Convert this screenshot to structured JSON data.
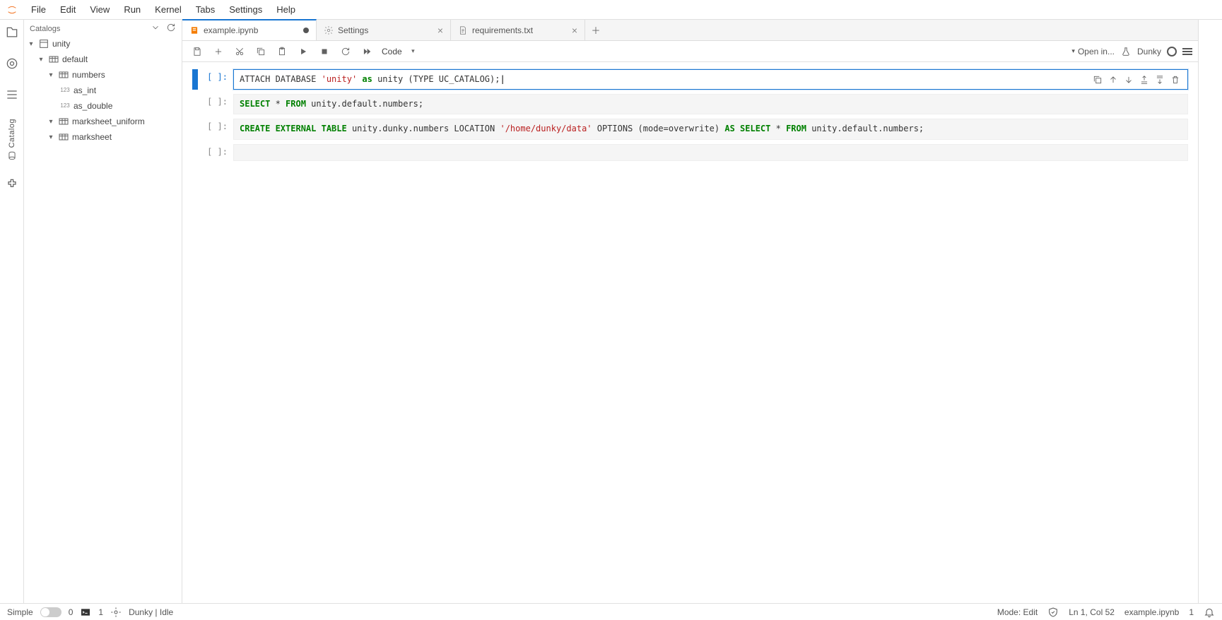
{
  "menu": {
    "items": [
      "File",
      "Edit",
      "View",
      "Run",
      "Kernel",
      "Tabs",
      "Settings",
      "Help"
    ]
  },
  "sidebar": {
    "title": "Catalogs",
    "tree": {
      "unity": "unity",
      "default": "default",
      "numbers": "numbers",
      "as_int": "as_int",
      "as_double": "as_double",
      "marksheet_uniform": "marksheet_uniform",
      "marksheet": "marksheet"
    }
  },
  "tabs": [
    {
      "name": "example.ipynb",
      "dirty": true,
      "kind": "notebook"
    },
    {
      "name": "Settings",
      "dirty": false,
      "kind": "settings"
    },
    {
      "name": "requirements.txt",
      "dirty": false,
      "kind": "text"
    }
  ],
  "toolbar": {
    "celltype": "Code",
    "openin": "Open in...",
    "kernel": "Dunky"
  },
  "cells": [
    {
      "prompt": "[ ]:",
      "tokens": [
        {
          "t": "ATTACH DATABASE ",
          "c": ""
        },
        {
          "t": "'unity'",
          "c": "s1"
        },
        {
          "t": " ",
          "c": ""
        },
        {
          "t": "as",
          "c": "k1"
        },
        {
          "t": " unity (TYPE UC_CATALOG);",
          "c": ""
        }
      ],
      "active": true
    },
    {
      "prompt": "[ ]:",
      "tokens": [
        {
          "t": "SELECT",
          "c": "k1"
        },
        {
          "t": " * ",
          "c": ""
        },
        {
          "t": "FROM",
          "c": "k1"
        },
        {
          "t": " unity.default.numbers;",
          "c": ""
        }
      ],
      "active": false
    },
    {
      "prompt": "[ ]:",
      "tokens": [
        {
          "t": "CREATE EXTERNAL TABLE",
          "c": "k1"
        },
        {
          "t": " unity.dunky.numbers LOCATION ",
          "c": ""
        },
        {
          "t": "'/home/dunky/data'",
          "c": "s1"
        },
        {
          "t": " OPTIONS (mode=overwrite) ",
          "c": ""
        },
        {
          "t": "AS SELECT",
          "c": "k1"
        },
        {
          "t": " * ",
          "c": ""
        },
        {
          "t": "FROM",
          "c": "k1"
        },
        {
          "t": " unity.default.numbers;",
          "c": ""
        }
      ],
      "active": false
    },
    {
      "prompt": "[ ]:",
      "tokens": [],
      "active": false
    }
  ],
  "statusbar": {
    "simple": "Simple",
    "count0": "0",
    "terminal_count": "1",
    "kernel_state": "Dunky | Idle",
    "mode": "Mode: Edit",
    "pos": "Ln 1, Col 52",
    "file": "example.ipynb",
    "ks": "1"
  },
  "activity_catalog_label": "Catalog"
}
